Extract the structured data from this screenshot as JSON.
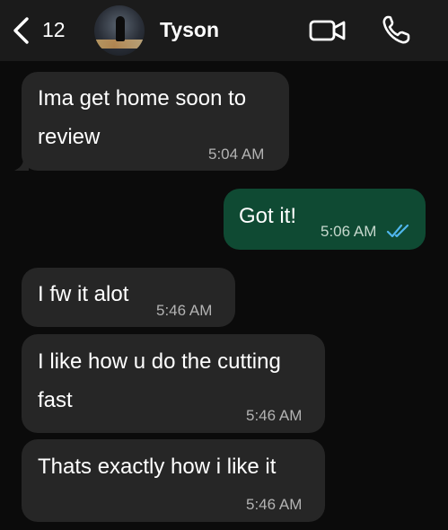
{
  "header": {
    "unread_count": "12",
    "contact_name": "Tyson"
  },
  "messages": [
    {
      "text_line1": "Ima get home soon to",
      "text_line2": "review",
      "time": "5:04 AM",
      "direction": "incoming"
    },
    {
      "text": "Got it!",
      "time": "5:06 AM",
      "direction": "outgoing",
      "status": "read"
    },
    {
      "text": "I fw it alot",
      "time": "5:46 AM",
      "direction": "incoming"
    },
    {
      "text_line1": "I like how u do the cutting",
      "text_line2": "fast",
      "time": "5:46 AM",
      "direction": "incoming"
    },
    {
      "text": "Thats exactly how i like it",
      "time": "5:46 AM",
      "direction": "incoming"
    }
  ],
  "colors": {
    "incoming_bubble": "#262626",
    "outgoing_bubble": "#0f4a33",
    "read_ticks": "#4fb6ec"
  }
}
